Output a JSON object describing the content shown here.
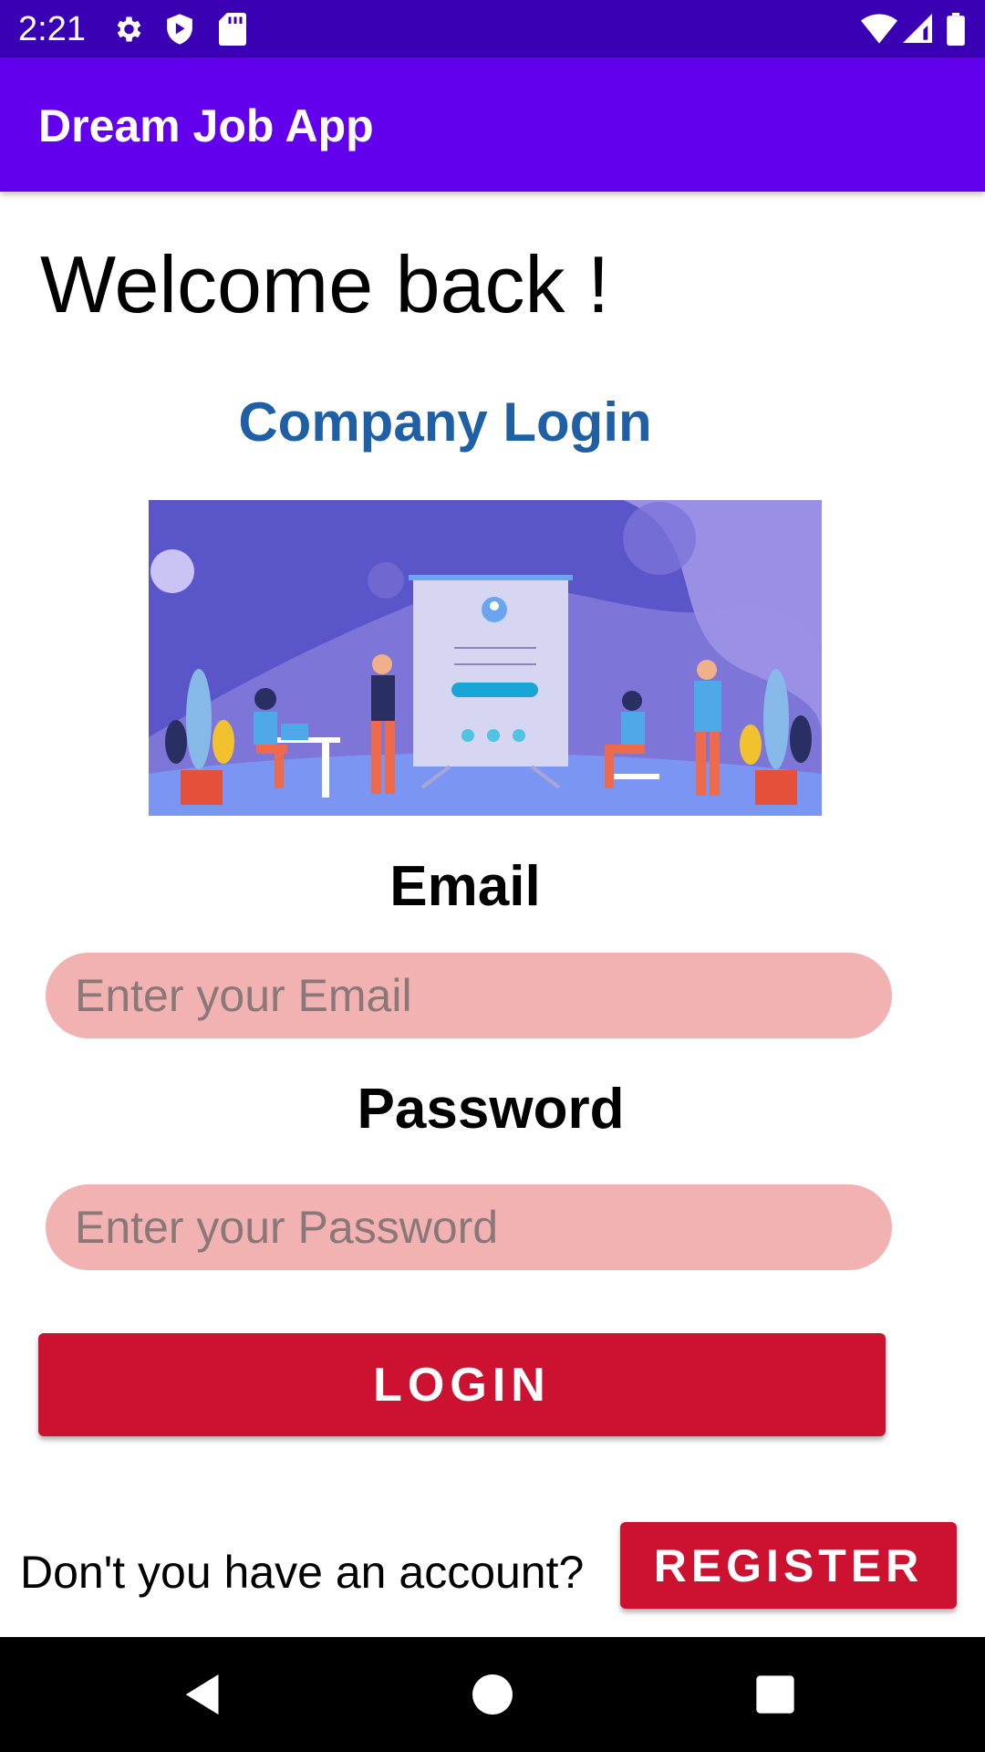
{
  "status_bar": {
    "time": "2:21",
    "left_icons": [
      "gear-icon",
      "shield-play-icon",
      "sd-card-icon"
    ],
    "right_icons": [
      "wifi-icon",
      "cell-signal-icon",
      "battery-icon"
    ]
  },
  "app_bar": {
    "title": "Dream Job App",
    "color": "#6200ee"
  },
  "welcome_text": "Welcome back !",
  "company_login_title": "Company Login",
  "illustration": {
    "icon": "login-illustration"
  },
  "email": {
    "label": "Email",
    "placeholder": "Enter your Email",
    "value": ""
  },
  "password": {
    "label": "Password",
    "placeholder": "Enter your Password",
    "value": ""
  },
  "login_button": {
    "label": "LOGIN",
    "color": "#cc1230"
  },
  "register_prompt": {
    "text": "Don't you have an account?",
    "button_label": "REGISTER"
  },
  "nav_bar": {
    "buttons": [
      "back-icon",
      "home-icon",
      "recents-icon"
    ]
  }
}
